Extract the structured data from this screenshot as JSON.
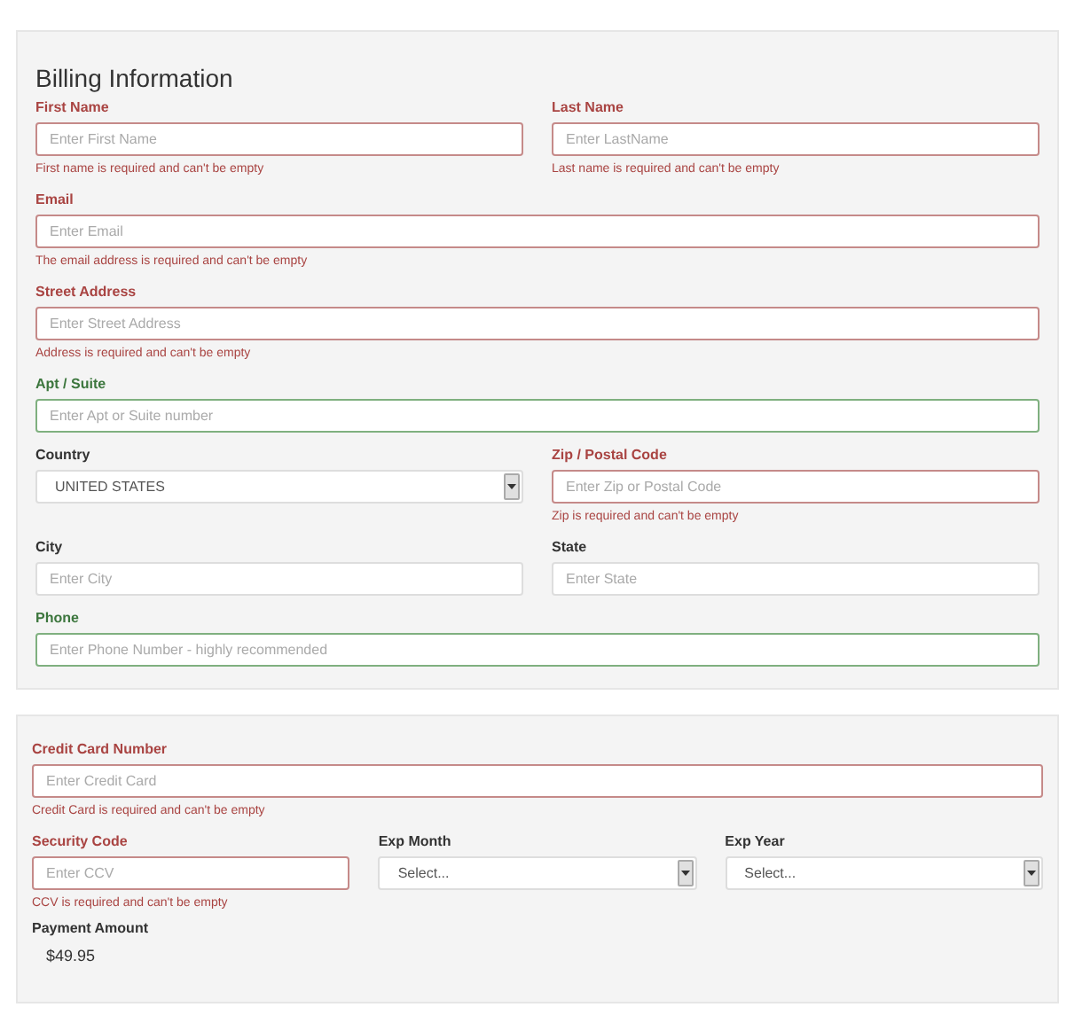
{
  "billing": {
    "title": "Billing Information",
    "rows": [
      [
        {
          "kind": "input",
          "label": "First Name",
          "placeholder": "Enter First Name",
          "invalid": true,
          "valid": false,
          "error": "First name is required and can't be empty"
        },
        {
          "kind": "input",
          "label": "Last Name",
          "placeholder": "Enter LastName",
          "invalid": true,
          "valid": false,
          "error": "Last name is required and can't be empty"
        }
      ],
      [
        {
          "kind": "input",
          "label": "Email",
          "placeholder": "Enter Email",
          "invalid": true,
          "valid": false,
          "error": "The email address is required and can't be empty"
        }
      ],
      [
        {
          "kind": "input",
          "label": "Street Address",
          "placeholder": "Enter Street Address",
          "invalid": true,
          "valid": false,
          "error": "Address is required and can't be empty"
        }
      ],
      [
        {
          "kind": "input",
          "label": "Apt / Suite",
          "placeholder": "Enter Apt or Suite number",
          "invalid": false,
          "valid": true
        }
      ],
      [
        {
          "kind": "select",
          "label": "Country",
          "value": "UNITED STATES",
          "invalid": false,
          "valid": false
        },
        {
          "kind": "input",
          "label": "Zip / Postal Code",
          "placeholder": "Enter Zip or Postal Code",
          "invalid": true,
          "valid": false,
          "error": "Zip is required and can't be empty"
        }
      ],
      [
        {
          "kind": "input",
          "label": "City",
          "placeholder": "Enter City",
          "invalid": false,
          "valid": false
        },
        {
          "kind": "input",
          "label": "State",
          "placeholder": "Enter State",
          "invalid": false,
          "valid": false
        }
      ],
      [
        {
          "kind": "input",
          "label": "Phone",
          "placeholder": "Enter Phone Number - highly recommended",
          "invalid": false,
          "valid": true
        }
      ]
    ]
  },
  "payment": {
    "rows": [
      [
        {
          "kind": "input",
          "label": "Credit Card Number",
          "placeholder": "Enter Credit Card",
          "invalid": true,
          "valid": false,
          "error": "Credit Card is required and can't be empty"
        }
      ],
      [
        {
          "kind": "input",
          "label": "Security Code",
          "placeholder": "Enter CCV",
          "invalid": true,
          "valid": false,
          "error": "CCV is required and can't be empty"
        },
        {
          "kind": "select",
          "label": "Exp Month",
          "value": "Select...",
          "invalid": false,
          "valid": false
        },
        {
          "kind": "select",
          "label": "Exp Year",
          "value": "Select...",
          "invalid": false,
          "valid": false
        }
      ]
    ],
    "amount_label": "Payment Amount",
    "amount": "$49.95"
  }
}
